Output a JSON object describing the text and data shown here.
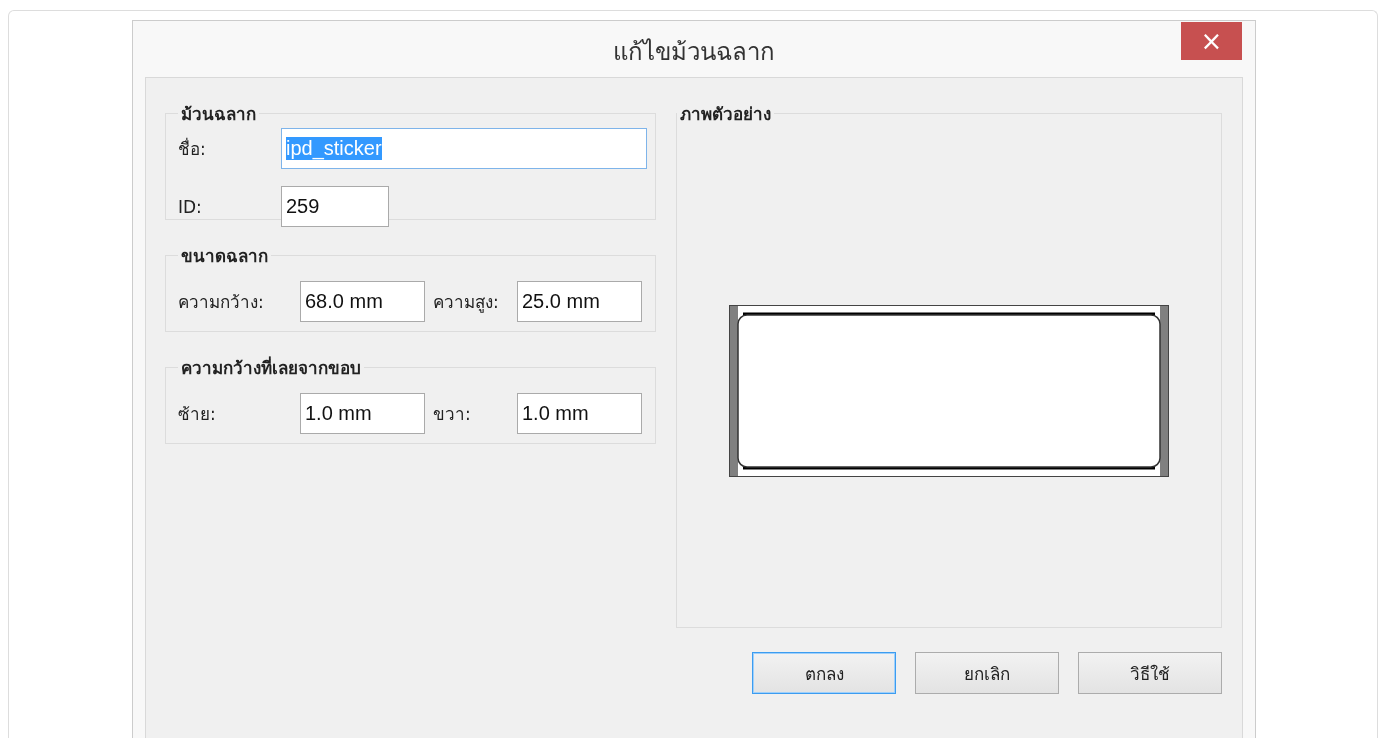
{
  "window": {
    "title": "แก้ไขม้วนฉลาก",
    "close": "×"
  },
  "groups": [
    {
      "title": "ม้วนฉลาก",
      "kind": "stacked",
      "fields": [
        {
          "label": "ชื่อ:",
          "value": "ipd_sticker",
          "focused": true,
          "text_selected": true
        },
        {
          "label": "ID:",
          "value": "259",
          "focused": false,
          "text_selected": false
        }
      ]
    },
    {
      "title": "ขนาดฉลาก",
      "kind": "paired",
      "fields": [
        {
          "label": "ความกว้าง:",
          "value": "68.0 mm",
          "focused": false,
          "text_selected": false
        },
        {
          "label": "ความสูง:",
          "value": "25.0 mm",
          "focused": false,
          "text_selected": false
        }
      ]
    },
    {
      "title": "ความกว้างที่เลยจากขอบ",
      "kind": "paired",
      "fields": [
        {
          "label": "ซ้าย:",
          "value": "1.0 mm",
          "focused": false,
          "text_selected": false
        },
        {
          "label": "ขวา:",
          "value": "1.0 mm",
          "focused": false,
          "text_selected": false
        }
      ]
    }
  ],
  "preview": {
    "title": "ภาพตัวอย่าง"
  },
  "buttons": [
    {
      "label": "ตกลง",
      "default": true
    },
    {
      "label": "ยกเลิก",
      "default": false
    },
    {
      "label": "วิธีใช้",
      "default": false
    }
  ]
}
